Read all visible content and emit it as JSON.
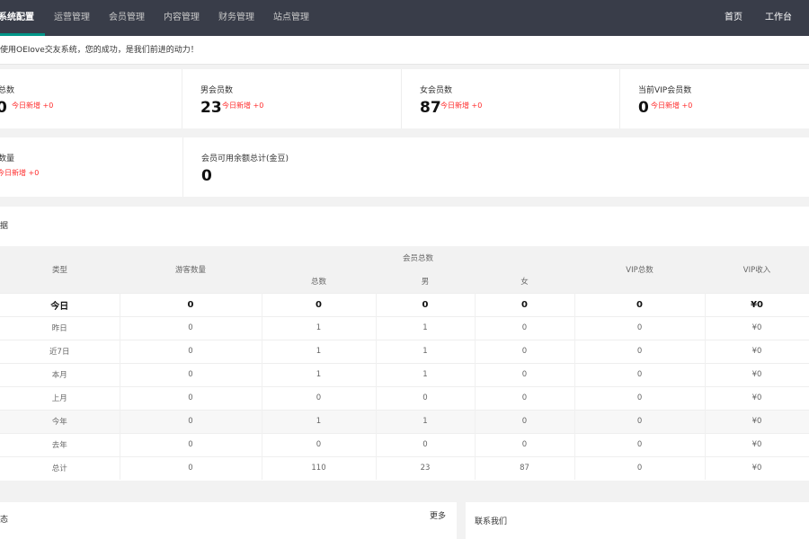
{
  "nav": {
    "items": [
      {
        "label": "系统配置",
        "active": true
      },
      {
        "label": "运营管理"
      },
      {
        "label": "会员管理"
      },
      {
        "label": "内容管理"
      },
      {
        "label": "财务管理"
      },
      {
        "label": "站点管理"
      }
    ],
    "right": [
      {
        "label": "首页"
      },
      {
        "label": "工作台"
      }
    ],
    "accent": "#009688"
  },
  "notice": "使用OEIove交友系统，您的成功，是我们前进的动力！",
  "stats_row1": [
    {
      "label": "总数",
      "value": "0",
      "today": "今日新增 +0"
    },
    {
      "label": "男会员数",
      "value": "23",
      "today": "今日新增 +0"
    },
    {
      "label": "女会员数",
      "value": "87",
      "today": "今日新增 +0"
    },
    {
      "label": "当前VIP会员数",
      "value": "0",
      "today": "今日新增 +0"
    }
  ],
  "stats_row2": [
    {
      "label": "数量",
      "today": "今日新增 +0"
    },
    {
      "label": "会员可用余额总计(金豆)",
      "value": "0"
    }
  ],
  "panel": {
    "title": "据",
    "headers": {
      "type": "类型",
      "visitors": "游客数量",
      "members_group": "会员总数",
      "total": "总数",
      "male": "男",
      "female": "女",
      "vip_total": "VIP总数",
      "vip_income": "VIP收入"
    },
    "rows": [
      {
        "type": "今日",
        "visitors": "0",
        "total": "0",
        "male": "0",
        "female": "0",
        "vip": "0",
        "income": "¥0"
      },
      {
        "type": "昨日",
        "visitors": "0",
        "total": "1",
        "male": "1",
        "female": "0",
        "vip": "0",
        "income": "¥0"
      },
      {
        "type": "近7日",
        "visitors": "0",
        "total": "1",
        "male": "1",
        "female": "0",
        "vip": "0",
        "income": "¥0"
      },
      {
        "type": "本月",
        "visitors": "0",
        "total": "1",
        "male": "1",
        "female": "0",
        "vip": "0",
        "income": "¥0"
      },
      {
        "type": "上月",
        "visitors": "0",
        "total": "0",
        "male": "0",
        "female": "0",
        "vip": "0",
        "income": "¥0"
      },
      {
        "type": "今年",
        "visitors": "0",
        "total": "1",
        "male": "1",
        "female": "0",
        "vip": "0",
        "income": "¥0"
      },
      {
        "type": "去年",
        "visitors": "0",
        "total": "0",
        "male": "0",
        "female": "0",
        "vip": "0",
        "income": "¥0"
      },
      {
        "type": "总计",
        "visitors": "0",
        "total": "110",
        "male": "23",
        "female": "87",
        "vip": "0",
        "income": "¥0"
      }
    ]
  },
  "bottom_left": {
    "title": "态",
    "more": "更多"
  },
  "bottom_right": {
    "title": "联系我们"
  }
}
